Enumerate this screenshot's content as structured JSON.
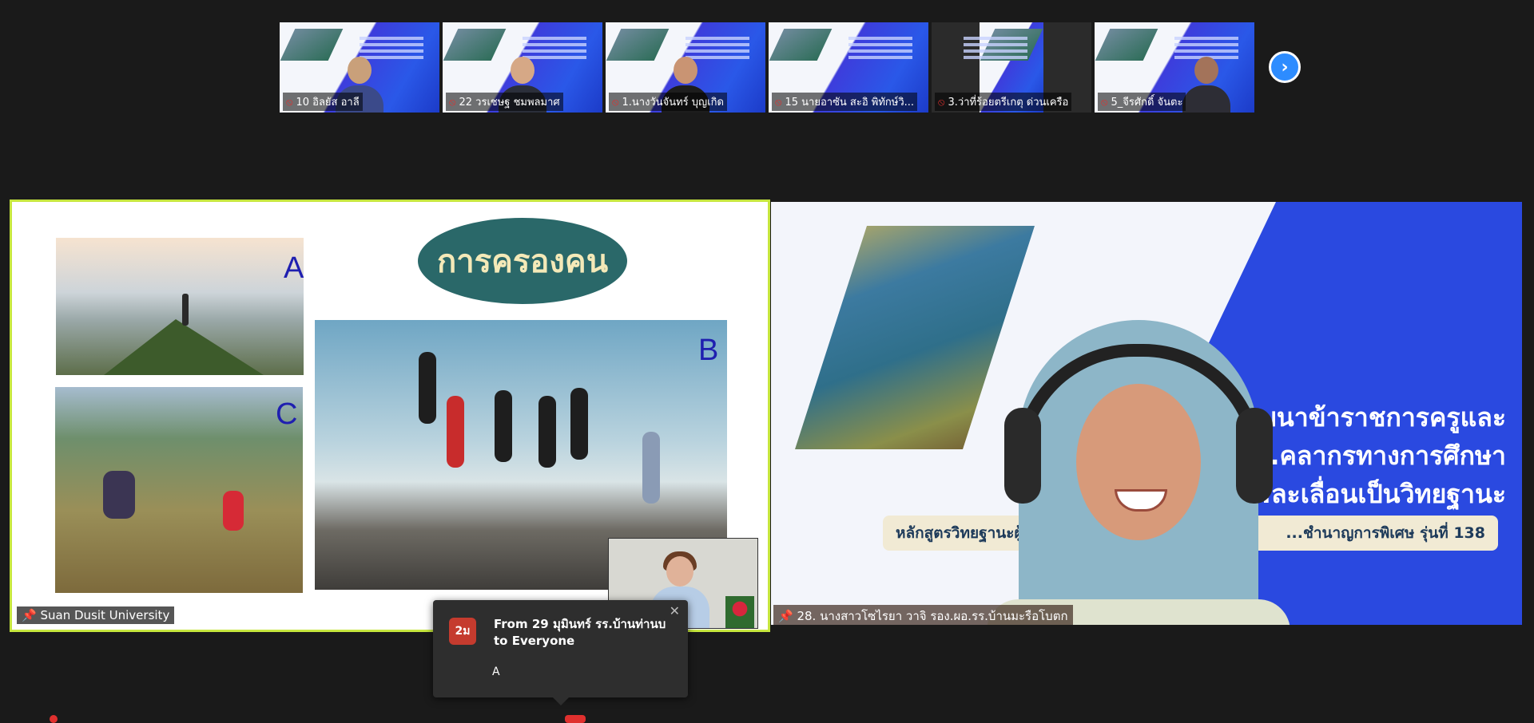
{
  "strip": {
    "participants": [
      {
        "name": "10 อิลยัส อาลี",
        "muted": true
      },
      {
        "name": "22 วรเชษฐ ชมพลมาศ",
        "muted": true
      },
      {
        "name": "1.นางวันจันทร์ บุญเกิด",
        "muted": true
      },
      {
        "name": "15 นายอาซัน สะอิ พิทักษ์วิ...",
        "muted": true
      },
      {
        "name": "3.ว่าที่ร้อยตรีเกตุ ด่วนเครือ",
        "muted": true
      },
      {
        "name": "5_จีรศักดิ์ จันตะ",
        "muted": true
      }
    ],
    "next_icon": "chevron-right-icon"
  },
  "slide": {
    "title": "การครองคน",
    "label_a": "A",
    "label_b": "B",
    "label_c": "C"
  },
  "tiles": {
    "left_name": "Suan Dusit University",
    "right_name": "28. นางสาวโซไรยา  วาจิ รอง.ผอ.รร.บ้านมะรือโบตก",
    "right_bg_text_1": "...ฒนาข้าราชการครูและ",
    "right_bg_text_2": "...คลากรทางการศึกษา",
    "right_bg_text_3": "ก...ละเลื่อนเป็นวิทยฐานะ",
    "right_banner_left": "หลักสูตรวิทยฐานะผู้อำนวย...",
    "right_banner_right": "...ชำนาญการพิเศษ รุ่นที่ 138"
  },
  "chat": {
    "avatar_text": "2ม",
    "from": "From 29 มุมินทร์ รร.บ้านท่านบ to Everyone",
    "message": "A"
  },
  "colors": {
    "active_speaker_border": "#c6e63e",
    "slide_title_bg": "#2a6869",
    "zoom_blue": "#2d8cff",
    "muted_red": "#e0302e"
  }
}
